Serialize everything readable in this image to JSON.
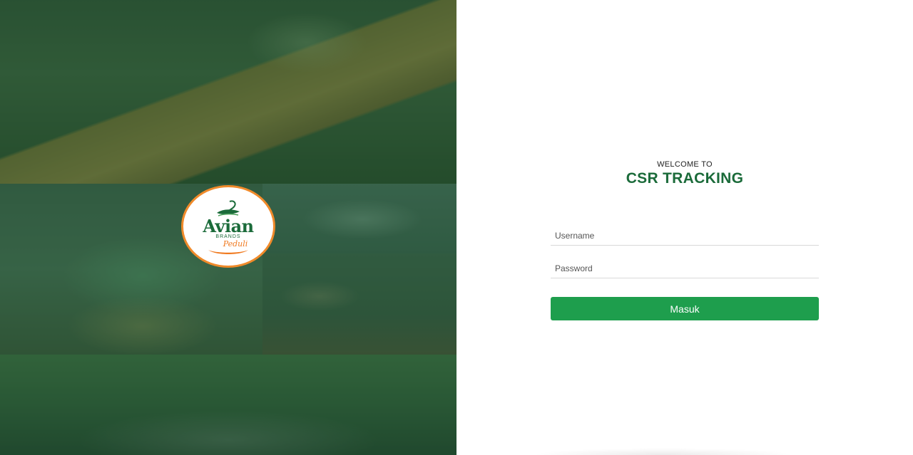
{
  "logo": {
    "word": "Avian",
    "sub": "BRANDS",
    "tagline": "Peduli"
  },
  "login": {
    "welcome": "WELCOME TO",
    "title": "CSR TRACKING",
    "username_placeholder": "Username",
    "password_placeholder": "Password",
    "submit_label": "Masuk"
  },
  "colors": {
    "brand_green": "#1b6b3a",
    "button_green": "#1e9e4d",
    "logo_orange": "#f08a2a"
  }
}
